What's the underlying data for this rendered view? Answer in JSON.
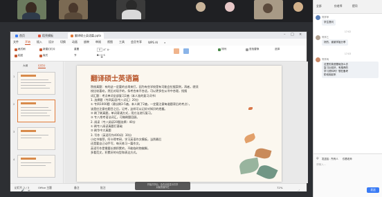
{
  "window": {
    "tabs": [
      "首页",
      "稻壳模板",
      "翻译硕士英语篇.pptx"
    ],
    "menu": [
      "文件",
      "开始",
      "插入",
      "设计",
      "切换",
      "动画",
      "放映",
      "审阅",
      "视图",
      "工具",
      "会员专享",
      "WPS AI"
    ],
    "ribbon": [
      "格式刷",
      "粘贴",
      "新建幻灯片",
      "版式",
      "重置",
      "节",
      "排列",
      "查找替换",
      "选择"
    ],
    "sidebar": {
      "tabs": [
        "大纲",
        "幻灯片"
      ],
      "thumbs": [
        "1",
        "2",
        "3",
        "4"
      ]
    },
    "status": {
      "slide": "幻灯片 2 / 3",
      "theme": "Office 主题",
      "notes": "备注",
      "comment": "批注",
      "zoom": "72%"
    }
  },
  "slide": {
    "title": "翻译硕士英语篇",
    "lines": [
      "院校真题：有的这一定要的去常来打，因为有些学校是有可能会拉锯案例，再者，就须",
      "校比较喜欢，然后对现子的，条考合来不合适，可以更多些从寻中合理，找搜",
      "词汇题：考点单词全部复习2遍（本人准的复习词书）",
      "1. 选择题（专四英语/专八词汇）20分",
      "① 专四1000题（建议刷3-5遍，本人刷了2遍，一定要注意每道题背后的考点），",
      "该是应注意在题目之后，记考，这样可以记好对知识的把握。",
      "② 刷了刷真题，单词背诵方式，用方法进行复习。",
      "③ 专八常考语法词汇，可做刷题回顾。",
      "2. 阅读（专八阅读20题选择）40分",
      "① 刷专八阅读真题打基础",
      "② 刷华中大真题",
      "3. 写作（英语写作400词）30分",
      "小红书推荐，阿卡得考研，学习英语作文模板，当然最后",
      "还是要自己动手写，每天练习一篇作文。",
      "英语写作是需要长期积累的，不能临时抱佛脚。",
      "多看范文，积累好的句型和表达方式。",
      "",
      "",
      "",
      "",
      ""
    ]
  },
  "tooltip": {
    "line1": "开始共享后，会在此处显示共享",
    "line2": "对象的操作栏"
  },
  "chat": {
    "tabs": [
      "全部",
      "仅老师",
      "提问"
    ],
    "messages": [
      {
        "sender": "同学甲",
        "text": "学生提问"
      },
      {
        "time": "17:02",
        "sender": "同学乙",
        "text": "好的，谢谢学姐分享"
      },
      {
        "time": "17:03",
        "sender": "同学丙",
        "lines": [
          "这里的英语基础怎么去",
          "复习比较好，有推荐的",
          "学习资料吗？想在备考",
          "阶段用起来"
        ]
      }
    ],
    "composer": {
      "options": [
        "发送给：所有人",
        "仅看老师"
      ],
      "placeholder": "请输入...",
      "send": "发送"
    }
  }
}
